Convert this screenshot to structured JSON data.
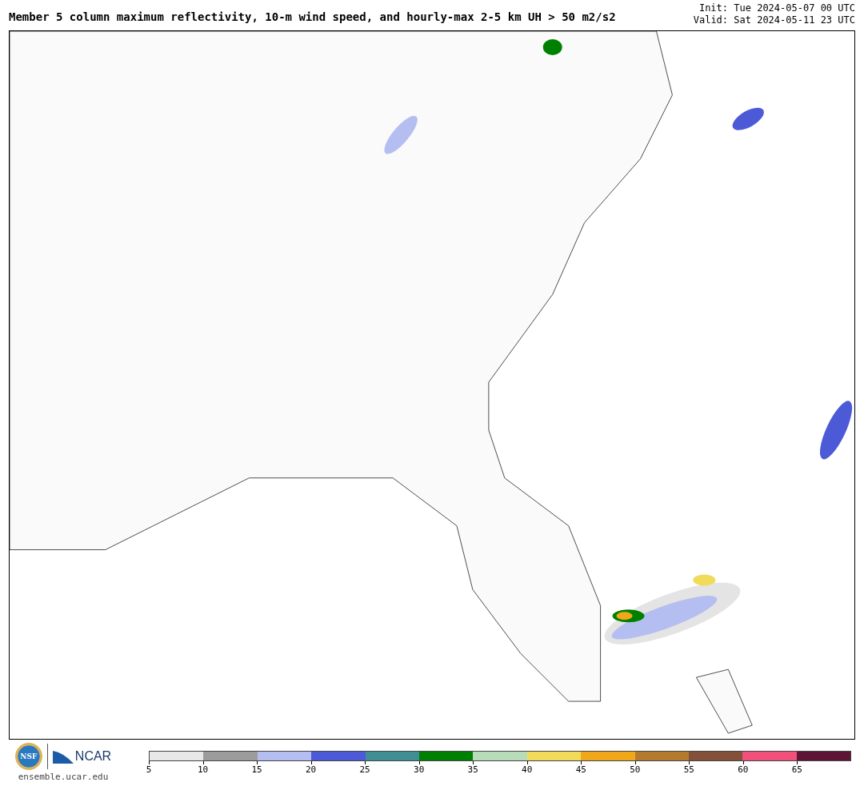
{
  "header": {
    "title": "Member 5 column maximum reflectivity, 10-m wind speed, and hourly-max 2-5 km UH > 50 m2/s2",
    "init": "Init: Tue 2024-05-07 00 UTC",
    "valid": "Valid: Sat 2024-05-11 23 UTC"
  },
  "footer": {
    "nsf_logo": "NSF",
    "ncar_logo": "NCAR",
    "site": "ensemble.ucar.edu"
  },
  "colorbar": {
    "bins": [
      {
        "label": "5",
        "color": "#e8e8e8"
      },
      {
        "label": "10",
        "color": "#9c9c9c"
      },
      {
        "label": "15",
        "color": "#b4bef0"
      },
      {
        "label": "20",
        "color": "#4c5ad8"
      },
      {
        "label": "25",
        "color": "#3f8f94"
      },
      {
        "label": "30",
        "color": "#008000"
      },
      {
        "label": "35",
        "color": "#b8dcb8"
      },
      {
        "label": "40",
        "color": "#f0dc5a"
      },
      {
        "label": "45",
        "color": "#f0a81a"
      },
      {
        "label": "50",
        "color": "#b47a2e"
      },
      {
        "label": "55",
        "color": "#83513a"
      },
      {
        "label": "60",
        "color": "#f0507a"
      },
      {
        "label": "65",
        "color": "#5e1535"
      }
    ]
  }
}
